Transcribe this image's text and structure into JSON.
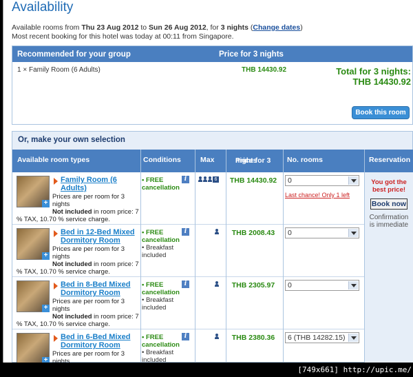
{
  "page": {
    "title": "Availability"
  },
  "info": {
    "line1_prefix": "Available rooms from ",
    "from_date": "Thu 23 Aug 2012",
    "to_word": " to ",
    "to_date": "Sun 26 Aug 2012",
    "for_word": ", for ",
    "nights": "3 nights",
    "change_open": " (",
    "change_dates": "Change dates",
    "change_close": ")",
    "line2": "Most recent booking for this hotel was today at 00:11 from Singapore."
  },
  "recommended": {
    "col1": "Recommended for your group",
    "col2": "Price for 3 nights",
    "room": "1 × Family Room (6 Adults)",
    "price": "THB 14430.92",
    "total_label": "Total for 3 nights:",
    "total_value": "THB 14430.92",
    "book_button": "Book this room"
  },
  "selection": {
    "title": "Or, make your own selection",
    "headers": {
      "room_types": "Available room types",
      "conditions": "Conditions",
      "max": "Max",
      "price_line1": "Price for 3",
      "price_line2": "nights",
      "no_rooms": "No. rooms",
      "reservation": "Reservation"
    },
    "rows": [
      {
        "name_line1": "Family Room (6",
        "name_line2": "Adults)",
        "desc1": "Prices are per room for 3",
        "desc2": "nights",
        "not_included": "Not included",
        "desc3": " in room price: 7",
        "desc4": "% TAX, 10.70 % service charge.",
        "free": "• FREE",
        "cancellation": "cancellation",
        "breakfast1": "",
        "breakfast2": "",
        "max_count": "6",
        "price": "THB 14430.92",
        "select": "0",
        "last_chance": "Last chance! Only 1 left"
      },
      {
        "name_line1": "Bed in 12-Bed Mixed",
        "name_line2": "Dormitory Room",
        "desc1": "Prices are per room for 3",
        "desc2": "nights",
        "not_included": "Not included",
        "desc3": " in room price: 7",
        "desc4": "% TAX, 10.70 % service charge.",
        "free": "• FREE",
        "cancellation": "cancellation",
        "breakfast1": "• Breakfast",
        "breakfast2": "included",
        "max_count": "",
        "price": "THB 2008.43",
        "select": "0",
        "last_chance": ""
      },
      {
        "name_line1": "Bed in 8-Bed Mixed",
        "name_line2": "Dormitory Room",
        "desc1": "Prices are per room for 3",
        "desc2": "nights",
        "not_included": "Not included",
        "desc3": " in room price: 7",
        "desc4": "% TAX, 10.70 % service charge.",
        "free": "• FREE",
        "cancellation": "cancellation",
        "breakfast1": "• Breakfast",
        "breakfast2": "included",
        "max_count": "",
        "price": "THB 2305.97",
        "select": "0",
        "last_chance": ""
      },
      {
        "name_line1": "Bed in 6-Bed Mixed",
        "name_line2": "Dormitory Room",
        "desc1": "Prices are per room for 3",
        "desc2": "nights",
        "not_included": "",
        "desc3": "",
        "desc4": "",
        "free": "• FREE",
        "cancellation": "cancellation",
        "breakfast1": "• Breakfast",
        "breakfast2": "included",
        "max_count": "",
        "price": "THB 2380.36",
        "select": "6  (THB 14282.15)",
        "last_chance": ""
      }
    ],
    "reservation": {
      "got_line1": "You got the",
      "got_line2": "best price!",
      "book_now": "Book now",
      "confirm_line1": "Confirmation",
      "confirm_line2": "is immediate"
    }
  },
  "watermark": "[749x661] http://upic.me/"
}
